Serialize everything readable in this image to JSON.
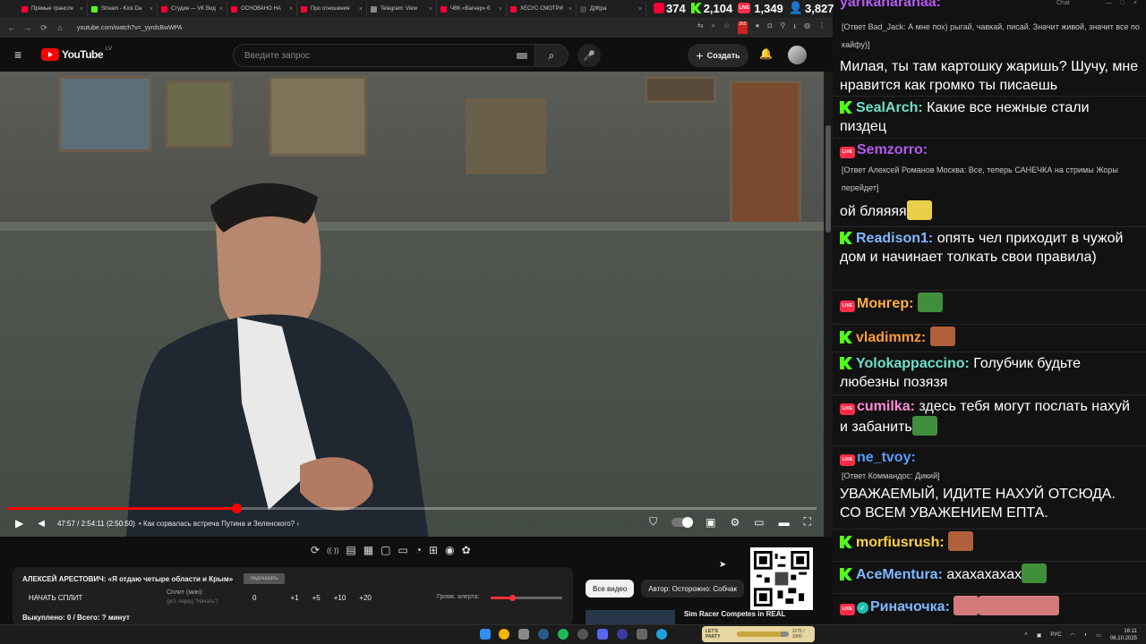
{
  "browser": {
    "tabs": [
      {
        "label": "Прямые трансля",
        "color": "#ff0033"
      },
      {
        "label": "Stream - Kick Da",
        "color": "#53fc18"
      },
      {
        "label": "Студия — VK Вид",
        "color": "#ff0033"
      },
      {
        "label": "ОСНОВАНО НА",
        "color": "#ff0033"
      },
      {
        "label": "Про отношения",
        "color": "#ff0033"
      },
      {
        "label": "Telegram: View",
        "color": "#888888"
      },
      {
        "label": "ЧВК «Вагнер» б",
        "color": "#ff0033"
      },
      {
        "label": "ХЕСУС СМОТРИ",
        "color": "#ff0033"
      },
      {
        "label": "Д|Ф|ра",
        "color": "#444444"
      }
    ],
    "url": "youtube.com/watch?v=_yyrdsBwWPA",
    "tab_close": "×",
    "extension_badge": "265"
  },
  "stats": {
    "viewers_youtube": "374",
    "viewers_kick": "2,104",
    "viewers_vk": "1,349",
    "total": "3,827"
  },
  "youtube": {
    "logo_text": "YouTube",
    "region": "LV",
    "search_placeholder": "Введите запрос",
    "create_label": "Создать",
    "create_icon": "+",
    "menu_icon": "≡",
    "search_icon": "⌕",
    "mic_icon": "🎤",
    "bell_icon": "🔔"
  },
  "player": {
    "progress": 0.2827,
    "time": "47:57 / 2:54:11 (2:50:50)",
    "chapter": "• Как сорвалась встреча Путина и Зеленского? ›",
    "play_icon": "▶",
    "volume_icon": "◀",
    "right_icons": [
      "▣",
      "⚙",
      "▭",
      "▬",
      "⛶"
    ]
  },
  "extension": {
    "icons": [
      "⟳",
      "((·))",
      "▤",
      "▦",
      "▢",
      "▭",
      "◔",
      "⊞",
      "◉",
      "✿"
    ]
  },
  "panel": {
    "title": "АЛЕКСЕЙ АРЕСТОВИЧ: «Я отдаю четыре области и Крым»",
    "badge": "подсказать",
    "split_button": "НАЧАТЬ СПЛИТ",
    "split_label": "Сплит (мин):",
    "split_sub": "(уст. перед \"Начать\")",
    "split_value": "0",
    "increments": [
      "+1",
      "+5",
      "+10",
      "+20"
    ],
    "alert_label": "Громк. алерта:",
    "alert_volume": 0.3,
    "summary": "Выкуплено: 0 / Всего: ? минут"
  },
  "sidebar": {
    "chips": [
      "Все видео",
      "Автор: Осторожно: Собчак"
    ],
    "rec_title": "Sim Racer Competes in REAL"
  },
  "chat": {
    "messages": [
      {
        "type": "text",
        "top": 0,
        "user": "",
        "text": "yarikanaranaa:"
      },
      {
        "type": "reply",
        "text": "[Ответ Bad_Jack: А мне пох) рыгай, чавкай, писай. Значит живой, значит все по кайфу)]"
      },
      {
        "type": "text",
        "text": "Милая, ты там картошку жаришь? Шучу, мне нравится как громко ты писаешь"
      },
      {
        "type": "msg",
        "badge": "kick",
        "user": "SealArch",
        "color": "#6fe0c9",
        "text": "Какие все нежные стали пиздец"
      },
      {
        "type": "msg",
        "badge": "live",
        "user": "Semzorro",
        "color": "#b45af2",
        "text": ""
      },
      {
        "type": "reply",
        "text": "[Ответ Алексей Романов Москва: Все, теперь САНЕЧКА на стримы Жоры перейдет]"
      },
      {
        "type": "text",
        "text": "ой бляяяя"
      },
      {
        "type": "msg",
        "badge": "kick",
        "user": "Readison1",
        "color": "#7fb8ff",
        "text": "опять чел приходит в чужой дом и начинает толкать свои правила)"
      },
      {
        "type": "msg",
        "badge": "live",
        "user": "Монгер",
        "color": "#ffb13b",
        "text": ""
      },
      {
        "type": "msg",
        "badge": "kick",
        "user": "vladimmz",
        "color": "#ff9a3c",
        "text": ""
      },
      {
        "type": "msg",
        "badge": "kick",
        "user": "Yolokappaccino",
        "color": "#6fe0c9",
        "text": "Голубчик будьте любезны позязя"
      },
      {
        "type": "msg",
        "badge": "live",
        "user": "cumilka",
        "color": "#ff8ad8",
        "text": "здесь тебя могут послать нахуй и забанить"
      },
      {
        "type": "msg",
        "badge": "live",
        "user": "ne_tvoy",
        "color": "#5a9bff",
        "text": ""
      },
      {
        "type": "reply",
        "text": "[Ответ Коммандос: Дикий]"
      },
      {
        "type": "text",
        "text": "УВАЖАЕМЫЙ, ИДИТЕ НАХУЙ ОТСЮДА. СО ВСЕМ УВАЖЕНИЕМ ЕПТА."
      },
      {
        "type": "msg",
        "badge": "kick",
        "user": "morfiusrush",
        "color": "#ffd23c",
        "text": ""
      },
      {
        "type": "msg",
        "badge": "kick",
        "user": "AceMentura",
        "color": "#7fb8ff",
        "text": "ахахахахах"
      },
      {
        "type": "msg",
        "badge": "live",
        "user": "Риначочка",
        "color": "#7fb8ff",
        "text": ""
      }
    ],
    "window_title": "Chat",
    "window_controls": [
      "—",
      "□",
      "×"
    ]
  },
  "taskbar": {
    "lang": "РУС",
    "time": "16:11",
    "date": "06.10.2025",
    "game_label": "LET'S PARTY",
    "game_progress_text": "1275 / 1500",
    "game_progress": 0.85
  },
  "colors": {
    "youtube_red": "#ff0000",
    "kick_green": "#53fc18",
    "live_red": "#ff2c48"
  }
}
